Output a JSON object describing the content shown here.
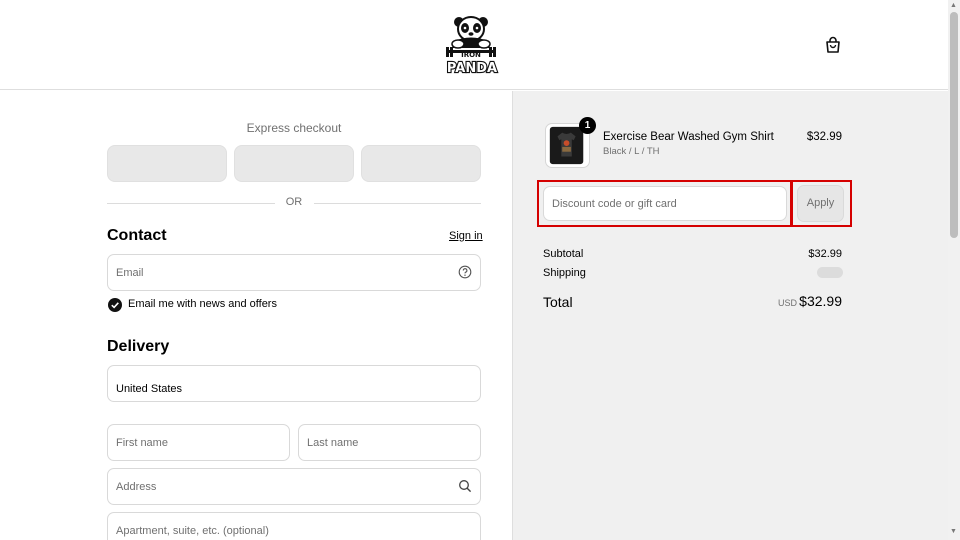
{
  "header": {
    "logo_text_top": "IRON",
    "logo_text_bottom": "PANDA"
  },
  "express": {
    "title": "Express checkout",
    "or": "OR"
  },
  "contact": {
    "heading": "Contact",
    "sign_in": "Sign in",
    "email_placeholder": "Email",
    "newsletter_label": "Email me with news and offers",
    "newsletter_checked": true
  },
  "delivery": {
    "heading": "Delivery",
    "country": "United States",
    "first_name_placeholder": "First name",
    "last_name_placeholder": "Last name",
    "address_placeholder": "Address",
    "apartment_placeholder": "Apartment, suite, etc. (optional)"
  },
  "order": {
    "item": {
      "name": "Exercise Bear Washed Gym Shirt",
      "variant": "Black / L / TH",
      "price": "$32.99",
      "quantity": "1"
    },
    "discount_placeholder": "Discount code or gift card",
    "apply_label": "Apply",
    "subtotal_label": "Subtotal",
    "subtotal_value": "$32.99",
    "shipping_label": "Shipping",
    "total_label": "Total",
    "total_currency": "USD",
    "total_value": "$32.99"
  },
  "colors": {
    "highlight": "#d50000",
    "summary_bg": "#f0f0f0"
  }
}
